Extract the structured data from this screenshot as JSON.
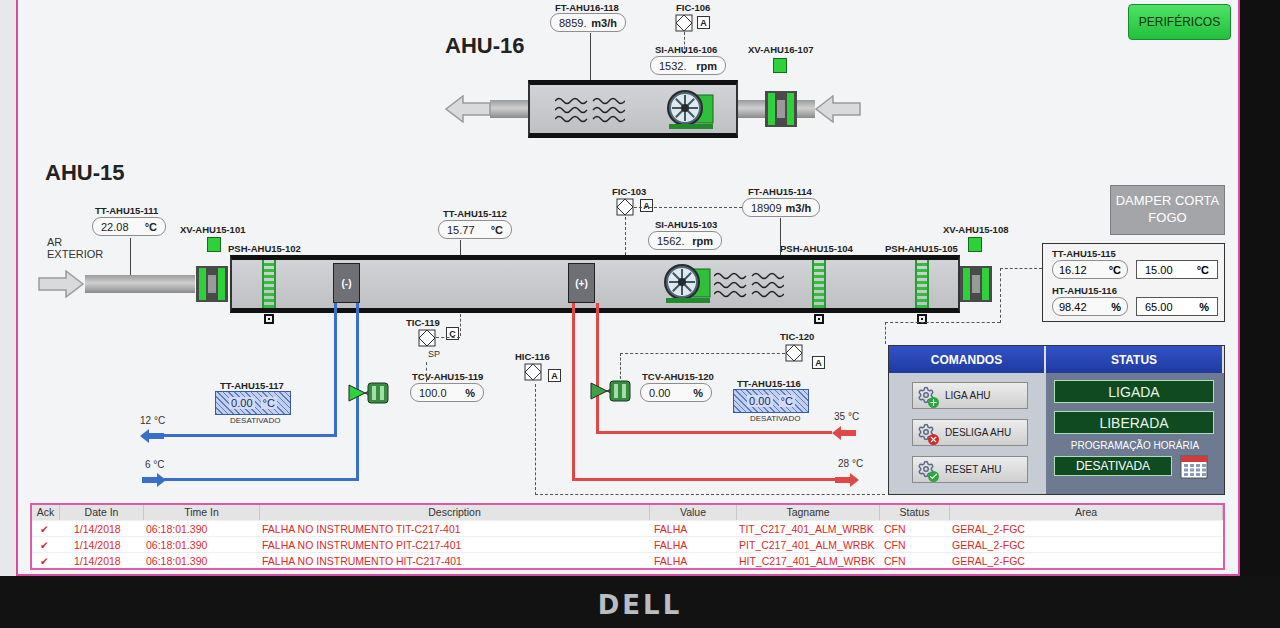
{
  "header": {
    "button": "PERIFÉRICOS"
  },
  "ahu16": {
    "title": "AHU-16",
    "flow": {
      "tag": "FT-AHU16-118",
      "value": "8859.",
      "unit": "m3/h"
    },
    "controller": {
      "tag": "FIC-106",
      "mode": "A"
    },
    "speed": {
      "tag": "SI-AHU16-106",
      "value": "1532.",
      "unit": "rpm"
    },
    "damper": {
      "tag": "XV-AHU16-107",
      "open": true
    }
  },
  "ahu15": {
    "title": "AHU-15",
    "inlet_label": [
      "AR",
      "EXTERIOR"
    ],
    "outdoor_temp": {
      "tag": "TT-AHU15-111",
      "value": "22.08",
      "unit": "°C"
    },
    "inlet_damper": {
      "tag": "XV-AHU15-101",
      "open": true
    },
    "filters": [
      {
        "tag": "PSH-AHU15-102"
      },
      {
        "tag": "PSH-AHU15-104"
      },
      {
        "tag": "PSH-AHU15-105"
      }
    ],
    "cooling_coil": {
      "symbol": "(-)"
    },
    "heating_coil": {
      "symbol": "(+)"
    },
    "supply_temp": {
      "tag": "TT-AHU15-112",
      "value": "15.77",
      "unit": "°C"
    },
    "flow_controller": {
      "tag": "FIC-103",
      "mode": "A"
    },
    "speed": {
      "tag": "SI-AHU15-103",
      "value": "1562.",
      "unit": "rpm"
    },
    "flow": {
      "tag": "FT-AHU15-114",
      "value": "18909",
      "unit": "m3/h"
    },
    "outlet_damper": {
      "tag": "XV-AHU15-108",
      "open": true
    },
    "fire_damper_button": "DAMPER CORTA FOGO",
    "room": [
      {
        "tag": "TT-AHU15-115",
        "value": "16.12",
        "unit": "°C",
        "setpoint": "15.00",
        "setpoint_unit": "°C"
      },
      {
        "tag": "HT-AHU15-116",
        "value": "98.42",
        "unit": "%",
        "setpoint": "65.00",
        "setpoint_unit": "%"
      }
    ],
    "cooling": {
      "controller": {
        "tag": "TIC-119",
        "mode": "C",
        "sp": "SP"
      },
      "valve": {
        "tag": "TCV-AHU15-119",
        "value": "100.0",
        "unit": "%",
        "level": 1
      },
      "return_temp": {
        "tag": "TT-AHU15-117",
        "value": "0.00",
        "unit": "°C",
        "status": "DESATIVADO",
        "disabled": true
      },
      "return_label": "12 °C",
      "supply_label": "6 °C"
    },
    "hand_controller": {
      "tag": "HIC-116",
      "mode": "A"
    },
    "heating": {
      "controller": {
        "tag": "TIC-120",
        "mode": "A"
      },
      "valve": {
        "tag": "TCV-AHU15-120",
        "value": "0.00",
        "unit": "%",
        "level": 0
      },
      "return_temp": {
        "tag": "TT-AHU15-116",
        "value": "0.00",
        "unit": "°C",
        "status": "DESATIVADO",
        "disabled": true
      },
      "supply_label": "35 °C",
      "return_label": "28 °C"
    },
    "commands": {
      "title": "COMANDOS",
      "buttons": [
        {
          "label": "LIGA AHU",
          "kind": "on"
        },
        {
          "label": "DESLIGA AHU",
          "kind": "off"
        },
        {
          "label": "RESET AHU",
          "kind": "reset"
        }
      ]
    },
    "status": {
      "title": "STATUS",
      "states": [
        "LIGADA",
        "LIBERADA"
      ],
      "schedule_label": "PROGRAMAÇÃO HORÁRIA",
      "schedule": "DESATIVADA"
    }
  },
  "alarms": {
    "columns": [
      "Ack",
      "Date In",
      "Time In",
      "Description",
      "Value",
      "Tagname",
      "Status",
      "Area"
    ],
    "rows": [
      {
        "ack": "✔",
        "date": "1/14/2018",
        "time": "06:18:01.390",
        "description": "FALHA NO INSTRUMENTO TIT-C217-401",
        "value": "FALHA",
        "tagname": "TIT_C217_401_ALM_WRBK",
        "status": "CFN",
        "area": "GERAL_2-FGC"
      },
      {
        "ack": "✔",
        "date": "1/14/2018",
        "time": "06:18:01.390",
        "description": "FALHA NO INSTRUMENTO PIT-C217-401",
        "value": "FALHA",
        "tagname": "PIT_C217_401_ALM_WRBK",
        "status": "CFN",
        "area": "GERAL_2-FGC"
      },
      {
        "ack": "✔",
        "date": "1/14/2018",
        "time": "06:18:01.390",
        "description": "FALHA NO INSTRUMENTO HIT-C217-401",
        "value": "FALHA",
        "tagname": "HIT_C217_401_ALM_WRBK",
        "status": "CFN",
        "area": "GERAL_2-FGC"
      }
    ]
  },
  "monitor": {
    "brand": "DELL"
  }
}
